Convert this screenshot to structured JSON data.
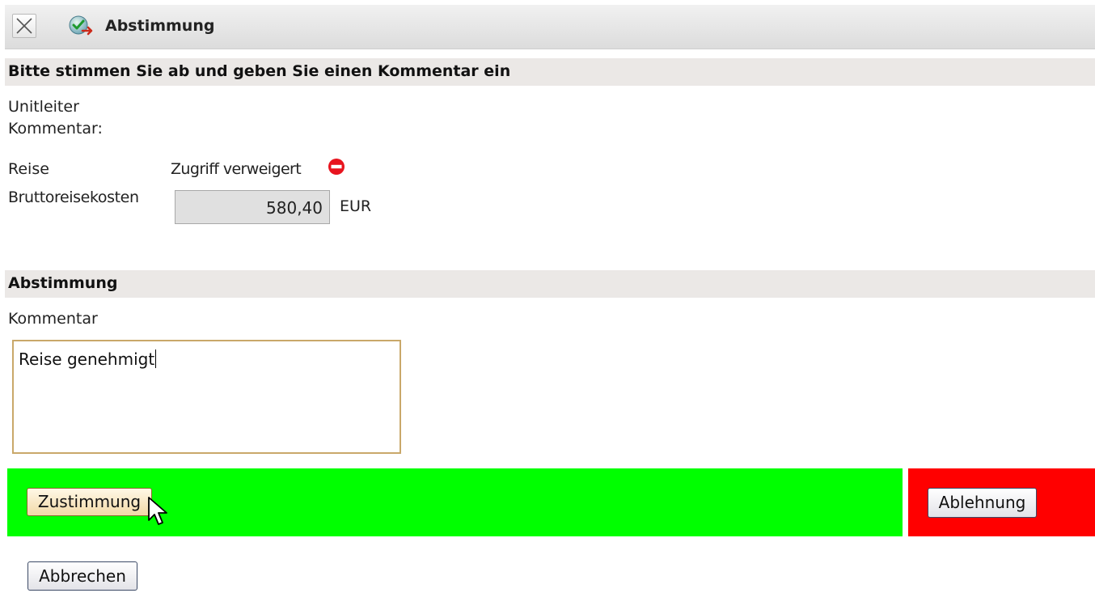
{
  "window": {
    "title": "Abstimmung",
    "close_icon": "close-icon",
    "app_icon": "approval-check-icon"
  },
  "info_section": {
    "heading": "Bitte stimmen Sie ab und geben Sie einen Kommentar ein",
    "unitleiter_label_line1": "Unitleiter",
    "unitleiter_label_line2": "Kommentar:",
    "reise_label": "Reise",
    "reise_value": "Zugriff verweigert",
    "reise_status_icon": "no-entry-icon",
    "kosten_label": "Bruttoreisekosten",
    "kosten_value": "580,40",
    "kosten_currency": "EUR"
  },
  "vote_section": {
    "heading": "Abstimmung",
    "comment_label": "Kommentar",
    "comment_value": "Reise genehmigt"
  },
  "actions": {
    "agree_label": "Zustimmung",
    "reject_label": "Ablehnung",
    "cancel_label": "Abbrechen",
    "agree_color": "#00ff00",
    "reject_color": "#ff0000"
  }
}
